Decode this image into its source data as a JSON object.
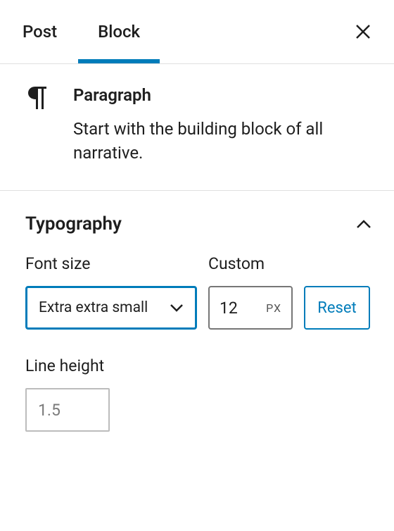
{
  "tabs": {
    "post": "Post",
    "block": "Block"
  },
  "block": {
    "title": "Paragraph",
    "description": "Start with the building block of all narrative."
  },
  "typography": {
    "section_title": "Typography",
    "font_size_label": "Font size",
    "font_size_value": "Extra extra small",
    "custom_label": "Custom",
    "custom_value": "12",
    "custom_unit": "PX",
    "reset_label": "Reset",
    "line_height_label": "Line height",
    "line_height_placeholder": "1.5"
  }
}
